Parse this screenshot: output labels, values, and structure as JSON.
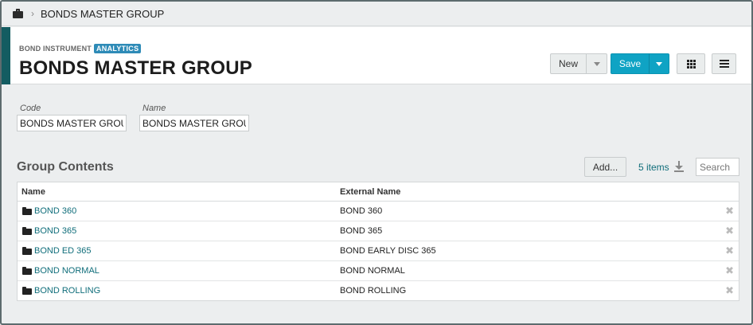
{
  "breadcrumb": {
    "home_icon": "briefcase-icon",
    "separator": "›",
    "current": "BONDS MASTER GROUP"
  },
  "header": {
    "kicker": "BOND INSTRUMENT",
    "badge": "ANALYTICS",
    "title": "BONDS MASTER GROUP",
    "accent_color": "#135c61"
  },
  "toolbar": {
    "new_label": "New",
    "save_label": "Save",
    "save_color": "#0fa3c4",
    "grid_icon": "grid-icon",
    "menu_icon": "hamburger-menu-icon"
  },
  "fields": {
    "code_label": "Code",
    "code_value": "BONDS MASTER GROUP",
    "name_label": "Name",
    "name_value": "BONDS MASTER GROUP"
  },
  "group_contents": {
    "title": "Group Contents",
    "add_label": "Add...",
    "items_count": "5 items",
    "search_placeholder": "Search",
    "columns": [
      "Name",
      "External Name"
    ],
    "rows": [
      {
        "name": "BOND 360",
        "external": "BOND 360"
      },
      {
        "name": "BOND 365",
        "external": "BOND 365"
      },
      {
        "name": "BOND ED 365",
        "external": "BOND EARLY DISC 365"
      },
      {
        "name": "BOND NORMAL",
        "external": "BOND NORMAL"
      },
      {
        "name": "BOND ROLLING",
        "external": "BOND ROLLING"
      }
    ],
    "remove_glyph": "✖"
  }
}
